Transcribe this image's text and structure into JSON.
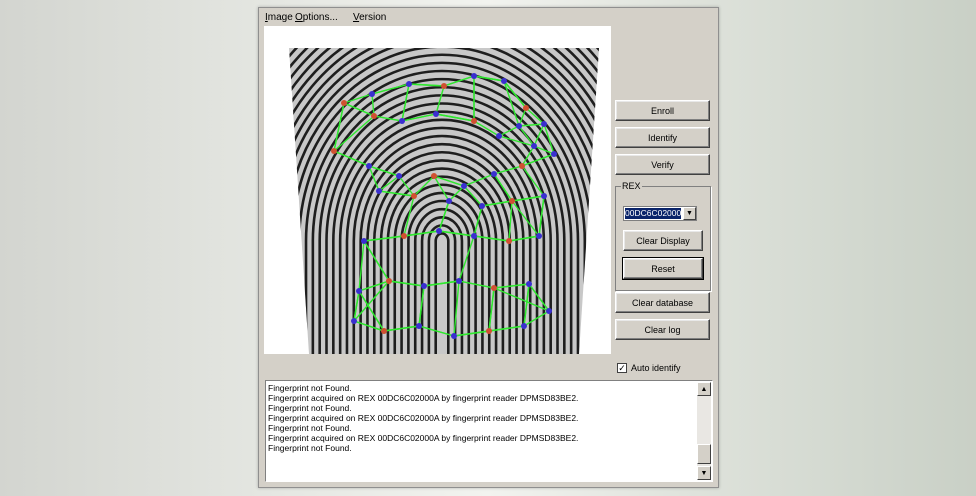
{
  "menu": {
    "image": "Image",
    "image_mnemonic": "I",
    "image_rest": "mage",
    "options_mnemonic": "O",
    "options_rest": "ptions...",
    "version_mnemonic": "V",
    "version_rest": "ersion"
  },
  "buttons": {
    "enroll": "Enroll",
    "identify": "Identify",
    "verify": "Verify",
    "clear_display": "Clear Display",
    "reset": "Reset",
    "clear_database": "Clear database",
    "clear_log": "Clear log"
  },
  "rex_group": {
    "label": "REX",
    "selected": "00DC6C02000A"
  },
  "auto_identify": {
    "label": "Auto identify",
    "checked": true,
    "check_glyph": "✓"
  },
  "log": {
    "lines": [
      "Fingerprint not Found.",
      "Fingerprint acquired on REX 00DC6C02000A by fingerprint reader DPMSD83BE2.",
      "Fingerprint not Found.",
      "Fingerprint acquired on REX 00DC6C02000A by fingerprint reader DPMSD83BE2.",
      "Fingerprint not Found.",
      "Fingerprint acquired on REX 00DC6C02000A by fingerprint reader DPMSD83BE2.",
      "Fingerprint not Found."
    ]
  },
  "icons": {
    "scroll_up": "▲",
    "scroll_down": "▼",
    "dropdown": "▼"
  },
  "colors": {
    "graph_edges": "#2ee82e",
    "minutia_blue": "#3a2fd0",
    "minutia_red": "#d05030",
    "selection": "#0a246a"
  }
}
